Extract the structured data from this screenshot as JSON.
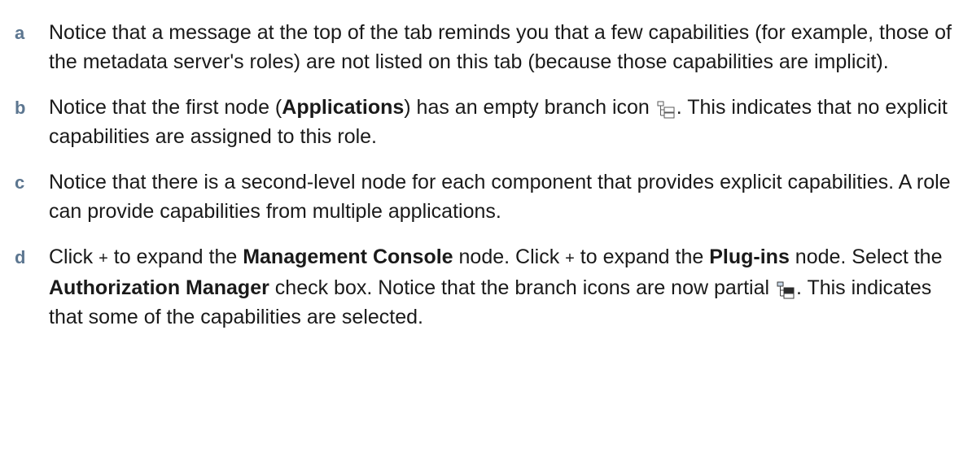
{
  "colors": {
    "step_letter": "#5c7690",
    "text": "#1a1a1a"
  },
  "steps": [
    {
      "letter": "a",
      "text": "Notice that a message at the top of the tab reminds you that a few capabilities (for example, those of the metadata server's roles) are not listed on this tab (because those capabilities are implicit)."
    },
    {
      "letter": "b",
      "t1": "Notice that the first node (",
      "b1": "Applications",
      "t2": ") has an empty branch icon ",
      "icon": "empty-branch-icon",
      "t3": ". This indicates that no explicit capabilities are assigned to this role."
    },
    {
      "letter": "c",
      "text": "Notice that there is a second-level node for each component that provides explicit capabilities. A role can provide capabilities from multiple applications."
    },
    {
      "letter": "d",
      "t1": "Click ",
      "plus1": "+",
      "t2": " to expand the ",
      "b1": "Management Console",
      "t3": " node. Click ",
      "plus2": "+",
      "t4": " to expand the ",
      "b2": "Plug-ins",
      "t5": " node. Select the ",
      "b3": "Authorization Manager",
      "t6": " check box. Notice that the branch icons are now partial ",
      "icon": "partial-branch-icon",
      "t7": ". This indicates that some of the capabilities are selected."
    }
  ]
}
